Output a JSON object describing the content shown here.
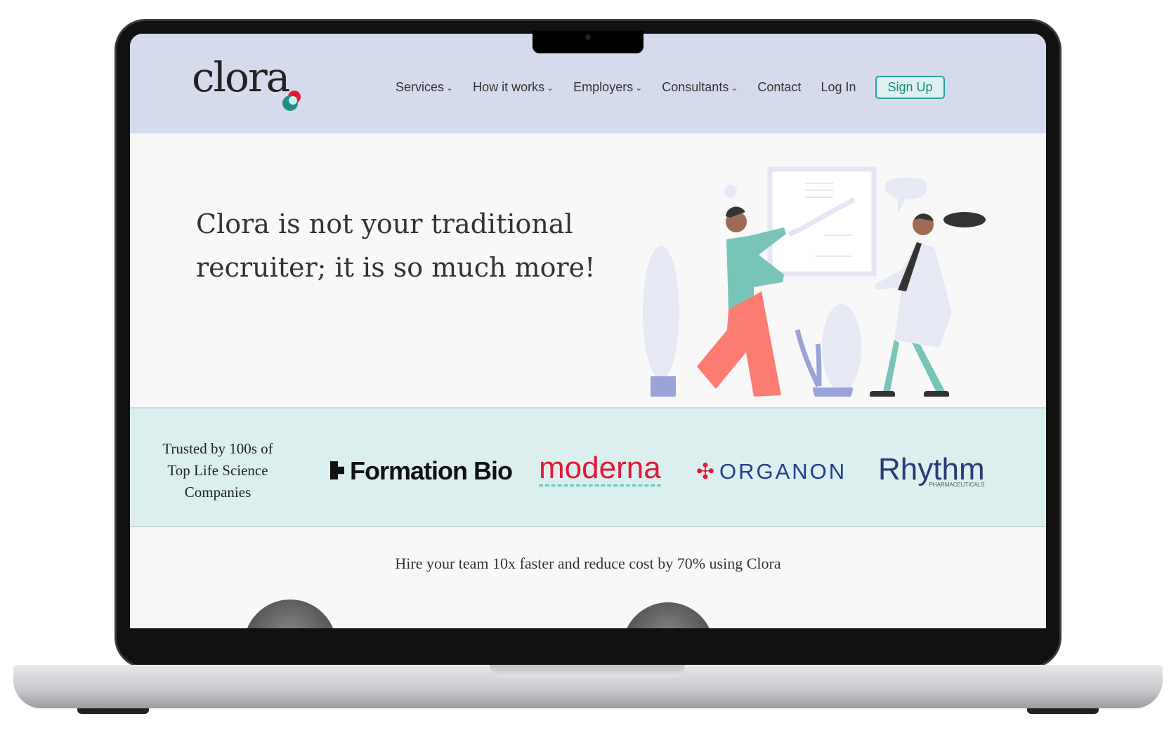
{
  "header": {
    "logo": "clora",
    "nav": [
      {
        "label": "Services",
        "dropdown": true
      },
      {
        "label": "How it works",
        "dropdown": true
      },
      {
        "label": "Employers",
        "dropdown": true
      },
      {
        "label": "Consultants",
        "dropdown": true
      },
      {
        "label": "Contact",
        "dropdown": false
      },
      {
        "label": "Log In",
        "dropdown": false
      }
    ],
    "signup": "Sign Up"
  },
  "hero": {
    "title": "Clora is not your traditional recruiter; it is so much more!"
  },
  "trust": {
    "text": "Trusted by 100s of Top Life Science Companies",
    "logos": [
      "Formation Bio",
      "moderna",
      "ORGANON",
      "Rhythm"
    ],
    "rhythm_sub": "PHARMACEUTICALS"
  },
  "main": {
    "tagline": "Hire your team 10x faster and reduce cost by 70% using Clora"
  },
  "colors": {
    "header_bg": "#d5dbed",
    "accent": "#2a9d9a",
    "trust_bg": "#dcefef",
    "moderna": "#e31837",
    "organon": "#1f3f8f",
    "rhythm": "#2a3a7a"
  }
}
